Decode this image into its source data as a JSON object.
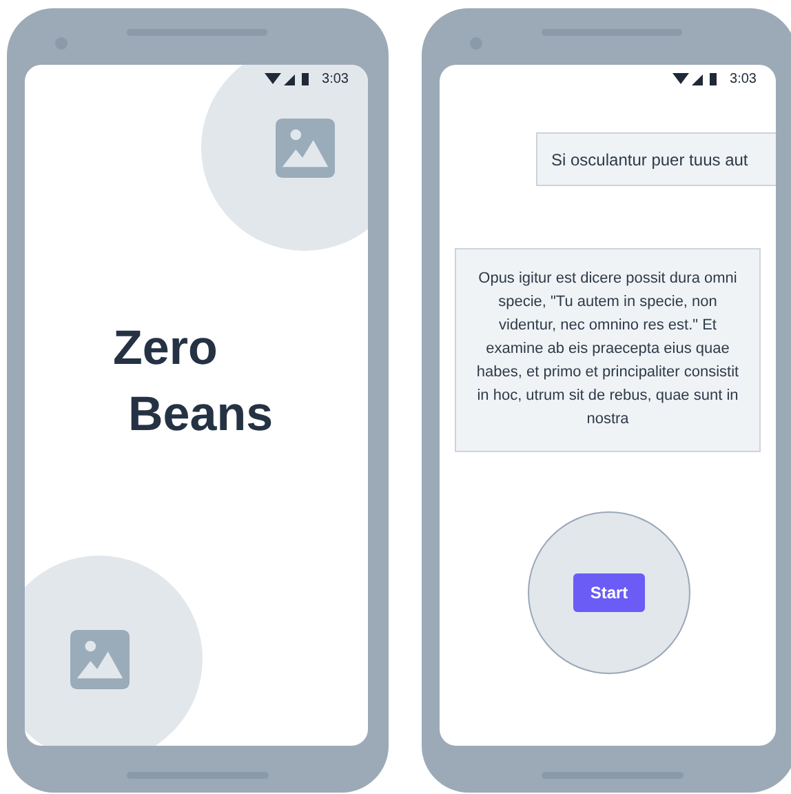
{
  "phones": [
    {
      "kind": "splash",
      "status_time": "3:03",
      "title_lines": [
        "Zero",
        "Beans"
      ]
    },
    {
      "kind": "content",
      "status_time": "3:03",
      "bubble": "Si osculantur puer tuus aut",
      "paragraph": "Opus igitur est dicere possit dura omni specie, \"Tu autem in specie, non videntur, nec omnino res est.\" Et examine ab eis praecepta eius quae habes, et primo et principaliter consistit in hoc, utrum sit de rebus, quae sunt in nostra",
      "button": "Start"
    }
  ]
}
